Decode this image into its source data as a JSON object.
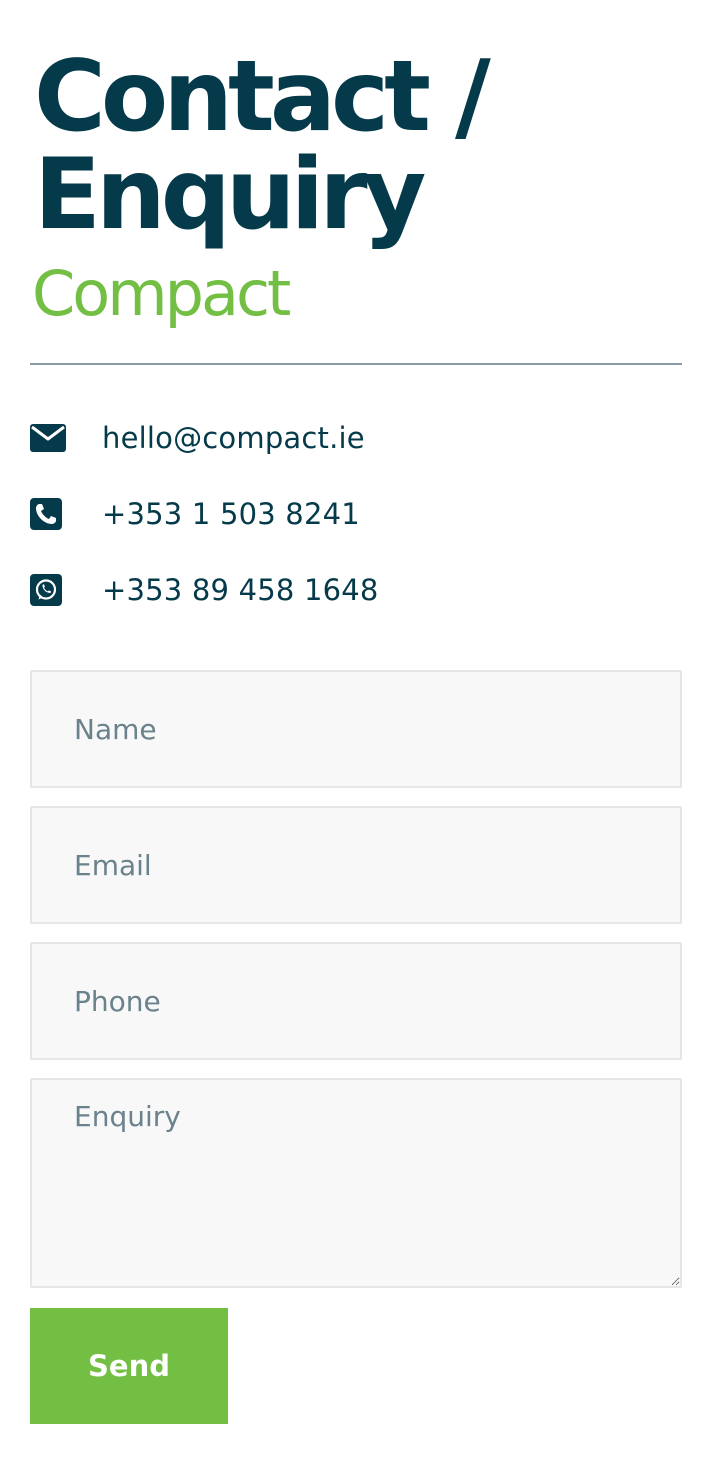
{
  "header": {
    "title_line1": "Contact /",
    "title_line2": "Enquiry",
    "brand": "Compact"
  },
  "contacts": [
    {
      "icon": "envelope-icon",
      "text": "hello@compact.ie"
    },
    {
      "icon": "phone-icon",
      "text": "+353 1 503 8241"
    },
    {
      "icon": "whatsapp-icon",
      "text": "+353 89 458 1648"
    }
  ],
  "form": {
    "name_placeholder": "Name",
    "email_placeholder": "Email",
    "phone_placeholder": "Phone",
    "enquiry_placeholder": "Enquiry",
    "send_label": "Send"
  },
  "colors": {
    "navy": "#053a4a",
    "green": "#72bf44",
    "field_bg": "#f8f8f8",
    "placeholder": "#6a828c"
  }
}
